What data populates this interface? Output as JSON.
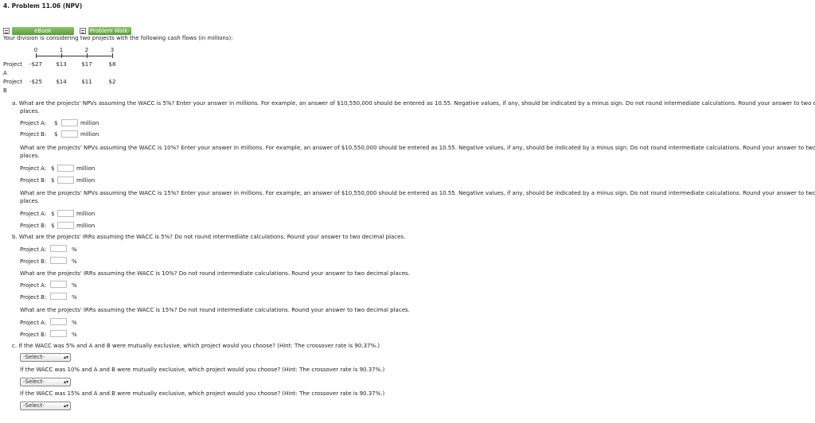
{
  "header": {
    "title": "4.  Problem 11.06 (NPV)"
  },
  "toolbar": {
    "ebook_label": "eBook",
    "walkthrough_label": "Problem Walk-"
  },
  "intro": "Your division is considering two projects with the following cash flows (in millions):",
  "timeline": {
    "periods": [
      "0",
      "1",
      "2",
      "3"
    ],
    "projects": [
      {
        "label_line1": "Project",
        "label_line2": "A",
        "flows": [
          "-$27",
          "$13",
          "$17",
          "$8"
        ]
      },
      {
        "label_line1": "Project",
        "label_line2": "B",
        "flows": [
          "-$25",
          "$14",
          "$11",
          "$2"
        ]
      }
    ]
  },
  "part_a": {
    "q1": "a.  What are the projects' NPVs assuming the WACC is 5%? Enter your answer in millions. For example, an answer of $10,550,000 should be entered as 10.55. Negative values, if any, should be indicated by a minus sign. Do not round intermediate calculations. Round your answer to two decimal",
    "q1_cont": "places.",
    "q2": "What are the projects' NPVs assuming the WACC is 10%? Enter your answer in millions. For example, an answer of $10,550,000 should be entered as 10.55. Negative values, if any, should be indicated by a minus sign. Do not round intermediate calculations. Round your answer to two decimal",
    "q2_cont": "places.",
    "q3": "What are the projects' NPVs assuming the WACC is 15%? Enter your answer in millions. For example, an answer of $10,550,000 should be entered as 10.55. Negative values, if any, should be indicated by a minus sign. Do not round intermediate calculations. Round your answer to two decimal",
    "q3_cont": "places.",
    "label_a": "Project A:",
    "label_b": "Project B:",
    "currency": "$",
    "unit": "million"
  },
  "part_b": {
    "q1": "b.  What are the projects' IRRs assuming the WACC is 5%? Do not round intermediate calculations. Round your answer to two decimal places.",
    "q2": "What are the projects' IRRs assuming the WACC is 10%? Do not round intermediate calculations. Round your answer to two decimal places.",
    "q3": "What are the projects' IRRs assuming the WACC is 15%? Do not round intermediate calculations. Round your answer to two decimal places.",
    "label_a": "Project A:",
    "label_b": "Project B:",
    "unit": "%"
  },
  "part_c": {
    "q1": "c.  If the WACC was 5% and A and B were mutually exclusive, which project would you choose? (Hint: The crossover rate is 90.37%.)",
    "q2": "If the WACC was 10% and A and B were mutually exclusive, which project would you choose? (Hint: The crossover rate is 90.37%.)",
    "q3": "If the WACC was 15% and A and B were mutually exclusive, which project would you choose? (Hint: The crossover rate is 90.37%.)",
    "select_value": "-Select-"
  }
}
